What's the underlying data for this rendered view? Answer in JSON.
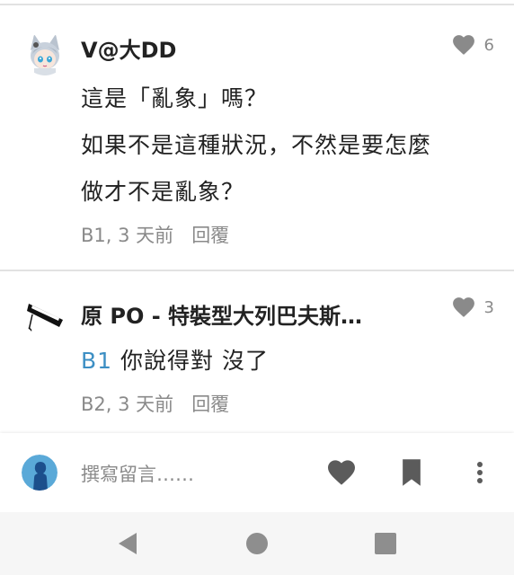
{
  "comments": [
    {
      "author": "V@大DD",
      "likes": "6",
      "lines": [
        "這是「亂象」嗎？",
        "如果不是這種狀況，不然是要怎麼",
        "做才不是亂象？"
      ],
      "floor": "B1",
      "time": "3 天前",
      "reply_label": "回覆",
      "avatar_icon": "anime-cat-girl-avatar"
    },
    {
      "author": "原 PO - 特裝型大列巴夫斯…",
      "likes": "3",
      "reply_to": "B1",
      "text": "你說得對 沒了",
      "floor": "B2",
      "time": "3 天前",
      "reply_label": "回覆",
      "avatar_icon": "black-flag-avatar"
    }
  ],
  "composer": {
    "placeholder": "撰寫留言……",
    "user_avatar_icon": "user-silhouette-avatar",
    "icons": [
      "heart-icon",
      "bookmark-icon",
      "more-vertical-icon"
    ]
  },
  "navbar": {
    "icons": [
      "back-triangle-icon",
      "home-circle-icon",
      "recent-square-icon"
    ]
  },
  "colors": {
    "link": "#3d8fc4",
    "meta": "#8a8a8a",
    "text": "#222222",
    "icon": "#5b5b5b",
    "avatar_bg": "#5aa9d8"
  }
}
